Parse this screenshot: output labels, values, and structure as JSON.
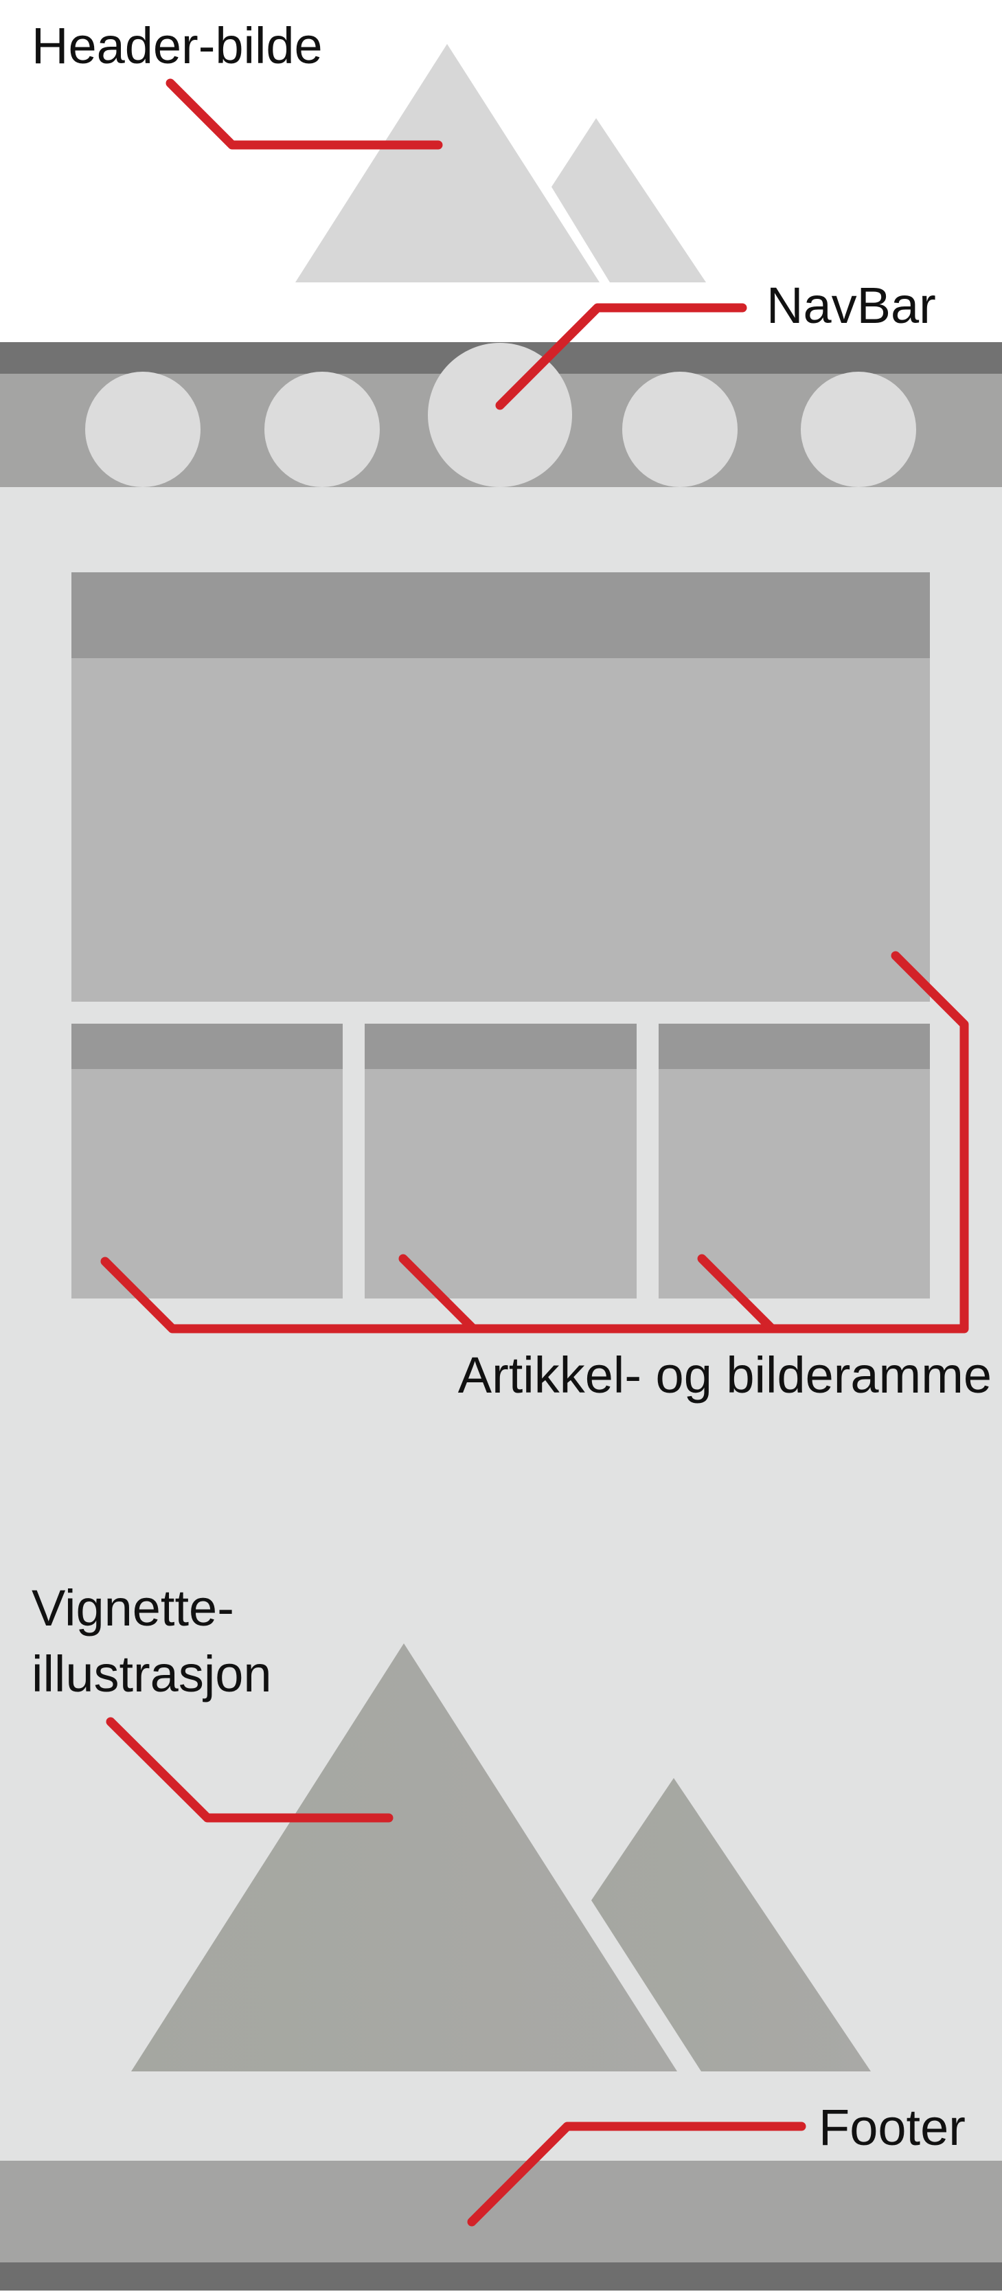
{
  "labels": {
    "header_image": "Header-bilde",
    "navbar": "NavBar",
    "article_frame": "Artikkel- og bilderamme",
    "vignette_line1": "Vignette-",
    "vignette_line2": "illustrasjon",
    "footer": "Footer"
  },
  "colors": {
    "background_white": "#ffffff",
    "page_background": "#e1e2e2",
    "navbar_top_strip": "#727272",
    "navbar_body": "#a4a4a3",
    "nav_circle": "#dcdcdc",
    "header_mountain": "#d7d7d7",
    "frame_header": "#989898",
    "frame_body": "#b6b6b6",
    "vignette_mountain": "#a7a8a3",
    "footer_body": "#a4a4a3",
    "footer_bottom_strip": "#6e6e6e",
    "callout_line": "#d32228",
    "label_text": "#111111"
  },
  "navbar": {
    "item_count": 5,
    "active_index": 2
  },
  "article_grid": {
    "main_frames": 1,
    "small_frames": 3
  },
  "icons": {
    "header": "mountain-illustration-icon",
    "vignette": "mountain-illustration-icon",
    "nav_items": "circle-icon"
  }
}
